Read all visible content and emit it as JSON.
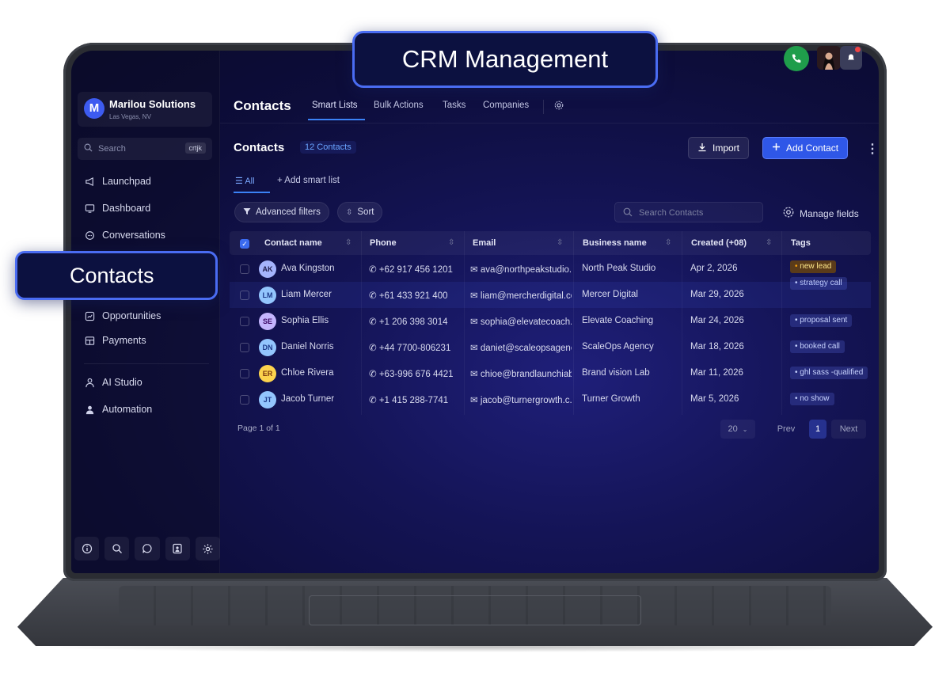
{
  "overlay": {
    "top_label": "CRM Management",
    "left_label": "Contacts"
  },
  "org": {
    "initial": "M",
    "name": "Marilou Solutions",
    "location": "Las Vegas, NV"
  },
  "sidebar": {
    "search_placeholder": "Search",
    "search_shortcut": "crtjk",
    "items": [
      {
        "label": "Launchpad",
        "icon": "megaphone-icon"
      },
      {
        "label": "Dashboard",
        "icon": "monitor-icon"
      },
      {
        "label": "Conversations",
        "icon": "chat-bubble-icon"
      },
      {
        "label": "Opportunities",
        "icon": "chart-square-icon"
      },
      {
        "label": "Payments",
        "icon": "payments-icon"
      },
      {
        "label": "AI Studio",
        "icon": "ai-person-icon"
      },
      {
        "label": "Automation",
        "icon": "users-icon"
      }
    ]
  },
  "topnav": {
    "title": "Contacts",
    "tabs": [
      "Smart Lists",
      "Bulk Actions",
      "Tasks",
      "Companies"
    ],
    "active_tab": "Smart Lists"
  },
  "header": {
    "title": "Contacts",
    "count": "12 Contacts",
    "import_label": "Import",
    "add_label": "Add Contact"
  },
  "smartlists": {
    "all_label": "All",
    "add_label": "Add smart list"
  },
  "toolbar": {
    "filters_label": "Advanced filters",
    "sort_label": "Sort",
    "search_placeholder": "Search Contacts",
    "manage_label": "Manage fields"
  },
  "table": {
    "columns": [
      "Contact name",
      "Phone",
      "Email",
      "Business name",
      "Created (+08)",
      "Tags"
    ],
    "rows": [
      {
        "initials": "AK",
        "name": "Ava Kingston",
        "phone": "+62 917 456 1201",
        "email": "ava@northpeakstudio.",
        "business": "North Peak Studio",
        "created": "Apr 2, 2026",
        "tags": [
          "new lead",
          "strategy call"
        ]
      },
      {
        "initials": "LM",
        "name": "Liam Mercer",
        "phone": "+61 433 921 400",
        "email": "liam@mercherdigital.co",
        "business": "Mercer Digital",
        "created": "Mar 29, 2026",
        "tags": []
      },
      {
        "initials": "SE",
        "name": "Sophia Ellis",
        "phone": "+1 206 398 3014",
        "email": "sophia@elevatecoach.",
        "business": "Elevate Coaching",
        "created": "Mar 24, 2026",
        "tags": [
          "proposal sent"
        ]
      },
      {
        "initials": "DN",
        "name": "Daniel Norris",
        "phone": "+44 7700-806231",
        "email": "daniet@scaleopsagenc.",
        "business": "ScaleOps Agency",
        "created": "Mar 18, 2026",
        "tags": [
          "booked call"
        ]
      },
      {
        "initials": "ER",
        "name": "Chloe Rivera",
        "phone": "+63-996 676 4421",
        "email": "chioe@brandlaunchiab.",
        "business": "Brand vision Lab",
        "created": "Mar 11, 2026",
        "tags": [
          "ghl sass -qualified"
        ]
      },
      {
        "initials": "JT",
        "name": "Jacob Turner",
        "phone": "+1 415 288-7741",
        "email": "jacob@turnergrowth.c.",
        "business": "Turner Growth",
        "created": "Mar 5, 2026",
        "tags": [
          "no show"
        ]
      }
    ]
  },
  "pagination": {
    "page_text": "Page 1 of 1",
    "per_page": "20",
    "prev": "Prev",
    "current": "1",
    "next": "Next"
  },
  "colors": {
    "accent": "#2f57e8",
    "call": "#1f9d4b",
    "tag_orange": "#f59e0b"
  }
}
